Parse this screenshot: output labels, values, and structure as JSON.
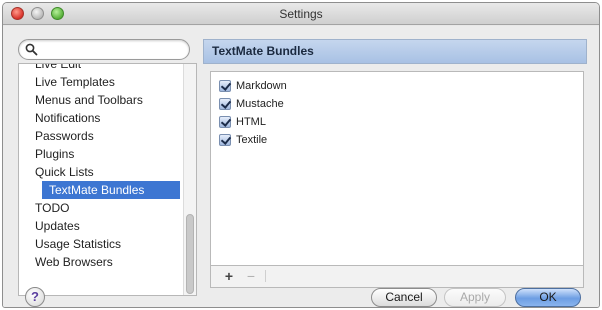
{
  "window": {
    "title": "Settings"
  },
  "search": {
    "value": "",
    "placeholder": ""
  },
  "sidebar": {
    "cut_item": "Live Edit",
    "items": [
      {
        "label": "Live Templates"
      },
      {
        "label": "Menus and Toolbars"
      },
      {
        "label": "Notifications"
      },
      {
        "label": "Passwords"
      },
      {
        "label": "Plugins"
      },
      {
        "label": "Quick Lists"
      },
      {
        "label": "TextMate Bundles",
        "selected": true
      },
      {
        "label": "TODO"
      },
      {
        "label": "Updates"
      },
      {
        "label": "Usage Statistics"
      },
      {
        "label": "Web Browsers"
      }
    ]
  },
  "panel": {
    "title": "TextMate Bundles",
    "bundles": [
      {
        "label": "Markdown",
        "checked": true
      },
      {
        "label": "Mustache",
        "checked": true
      },
      {
        "label": "HTML",
        "checked": true
      },
      {
        "label": "Textile",
        "checked": true
      }
    ],
    "toolbar": {
      "add_label": "+",
      "remove_label": "−"
    }
  },
  "footer": {
    "help_label": "?",
    "cancel_label": "Cancel",
    "apply_label": "Apply",
    "ok_label": "OK"
  },
  "colors": {
    "selection": "#3d76d2",
    "header_bg": "#b7cbe9",
    "ok_button": "#6d9ee3"
  }
}
